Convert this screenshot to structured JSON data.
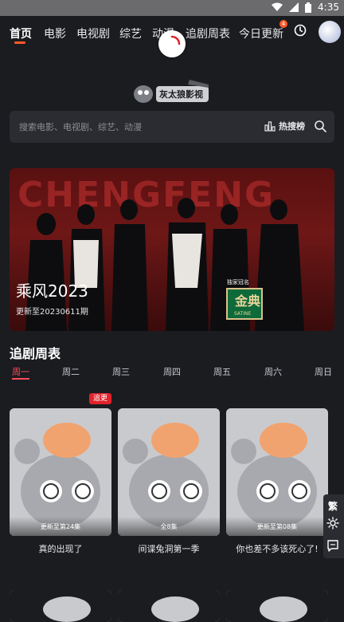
{
  "status": {
    "time": "4:35"
  },
  "nav": {
    "items": [
      "首页",
      "电影",
      "电视剧",
      "综艺",
      "动漫",
      "追剧周表",
      "今日更新"
    ],
    "badge": "4"
  },
  "logo_text": "灰太狼影视",
  "search": {
    "placeholder": "搜索电影、电视剧、综艺、动漫",
    "hot_label": "热搜榜"
  },
  "banner": {
    "bg_text": "CHENGFENG",
    "title": "乘风2023",
    "subtitle": "更新至20230611期",
    "sponsor_label": "独家冠名",
    "sponsor_name": "金典",
    "sponsor_sub": "SATINE"
  },
  "schedule": {
    "title": "追剧周表",
    "days": [
      "周一",
      "周二",
      "周三",
      "周四",
      "周五",
      "周六",
      "周日"
    ],
    "update_tag": "追更",
    "cards": [
      {
        "caption": "更新至第24集",
        "title": "真的出现了"
      },
      {
        "caption": "全8集",
        "title": "间谍兔洞第一季"
      },
      {
        "caption": "更新至第08集",
        "title": "你也差不多该死心了!"
      }
    ]
  },
  "sidebar": {
    "traditional_label": "繁"
  },
  "colors": {
    "accent": "#ff4b5a",
    "nav_underline": "#ff5a2a",
    "background": "#1b1c20"
  }
}
